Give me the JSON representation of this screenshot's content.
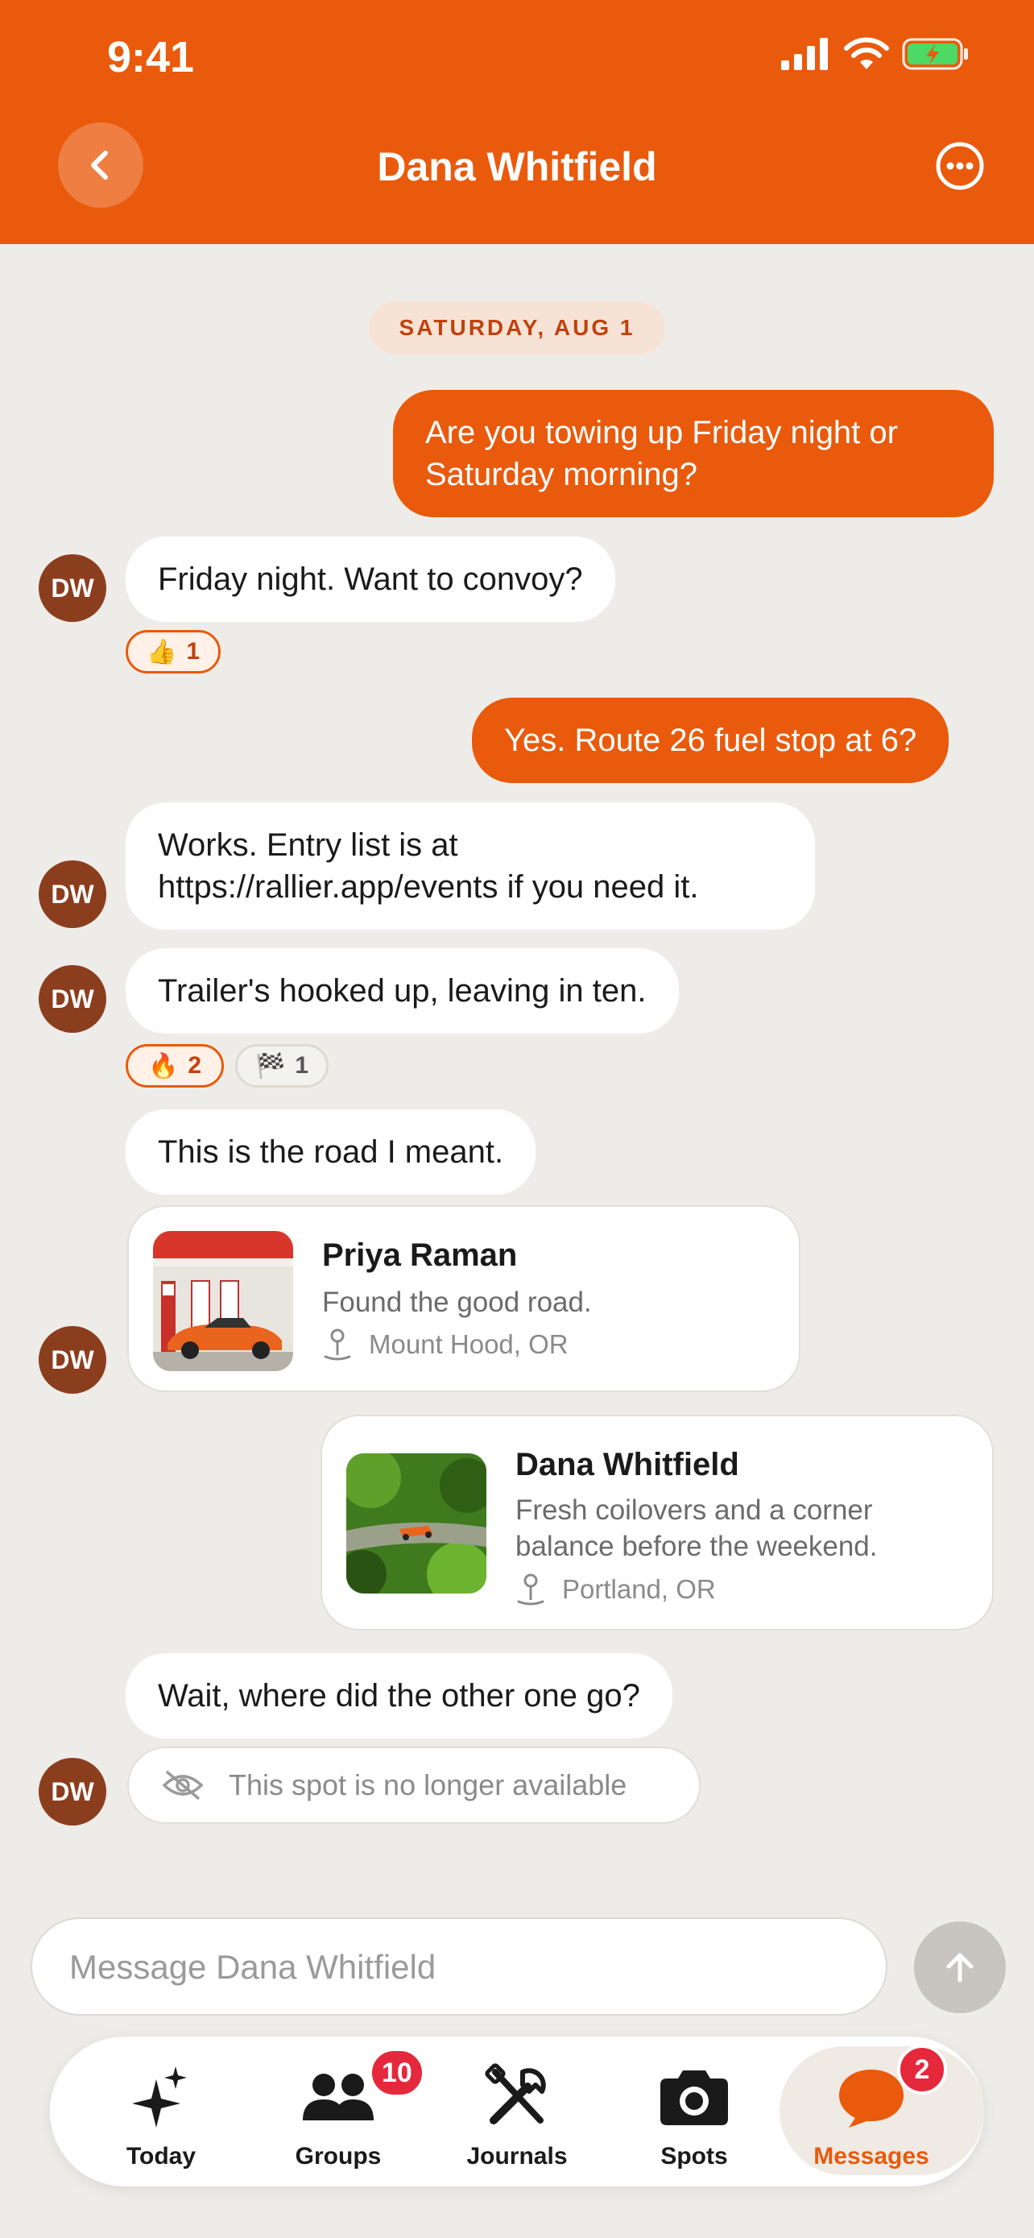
{
  "status_bar": {
    "time": "9:41"
  },
  "header": {
    "title": "Dana Whitfield"
  },
  "date_separator": "SATURDAY, AUG 1",
  "avatar_initials": "DW",
  "messages": [
    {
      "text": "Are you towing up Friday night or Saturday morning?",
      "sender": "me"
    },
    {
      "text": "Friday night. Want to convoy?",
      "sender": "Dana Whitfield"
    },
    {
      "text": "Yes. Route 26 fuel stop at 6?",
      "sender": "me"
    },
    {
      "text": "Works. Entry list is at https://rallier.app/events if you need it.",
      "sender": "Dana Whitfield"
    },
    {
      "text": "Trailer's hooked up, leaving in ten.",
      "sender": "Dana Whitfield"
    },
    {
      "text": "This is the road I meant.",
      "sender": "Dana Whitfield"
    },
    {
      "text": "Wait, where did the other one go?",
      "sender": "Dana Whitfield"
    }
  ],
  "reactions": [
    {
      "emoji": "👍",
      "count": "1"
    },
    {
      "emoji": "🔥",
      "count": "2"
    },
    {
      "emoji": "🏁",
      "count": "1"
    }
  ],
  "spot_cards": [
    {
      "name": "Priya Raman",
      "description": "Found the good road.",
      "location": "Mount Hood, OR"
    },
    {
      "name": "Dana Whitfield",
      "description": "Fresh coilovers and a corner balance before the weekend.",
      "location": "Portland, OR"
    }
  ],
  "unavailable_text": "This spot is no longer available",
  "composer": {
    "placeholder": "Message Dana Whitfield"
  },
  "tabs": [
    {
      "label": "Today",
      "icon": "sparkle-icon"
    },
    {
      "label": "Groups",
      "icon": "people-icon",
      "badge": "10"
    },
    {
      "label": "Journals",
      "icon": "tools-icon"
    },
    {
      "label": "Spots",
      "icon": "camera-icon"
    },
    {
      "label": "Messages",
      "icon": "chat-icon",
      "badge": "2",
      "active": true
    }
  ],
  "colors": {
    "accent": "#E95A0C",
    "avatar": "#8B3E1E",
    "badge": "#E5283B",
    "background": "#EEECE8"
  }
}
